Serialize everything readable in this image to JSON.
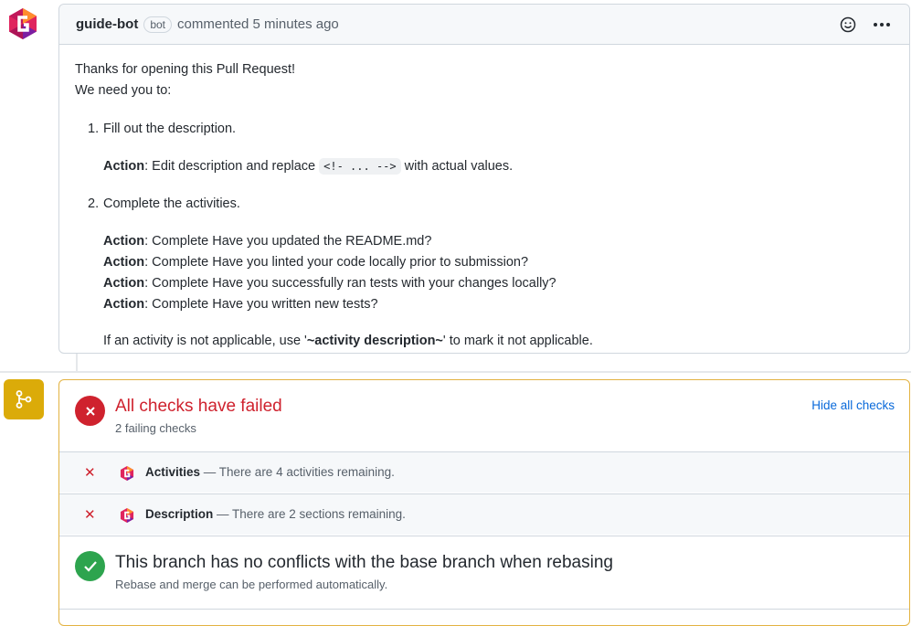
{
  "comment": {
    "author": "guide-bot",
    "badge": "bot",
    "timestamp": "commented 5 minutes ago",
    "intro_1": "Thanks for opening this Pull Request!",
    "intro_2": "We need you to:",
    "items": [
      {
        "number": "1.",
        "text": "Fill out the description.",
        "actions": [
          {
            "label": "Action",
            "text_before": ": Edit description and replace ",
            "code": "<!- ... -->",
            "text_after": " with actual values."
          }
        ]
      },
      {
        "number": "2.",
        "text": "Complete the activities.",
        "actions": [
          {
            "label": "Action",
            "text": ": Complete Have you updated the README.md?"
          },
          {
            "label": "Action",
            "text": ": Complete Have you linted your code locally prior to submission?"
          },
          {
            "label": "Action",
            "text": ": Complete Have you successfully ran tests with your changes locally?"
          },
          {
            "label": "Action",
            "text": ": Complete Have you written new tests?"
          }
        ]
      }
    ],
    "footer_before": "If an activity is not applicable, use '",
    "footer_bold": "~activity description~",
    "footer_after": "' to mark it not applicable."
  },
  "checks": {
    "title": "All checks have failed",
    "subtitle": "2 failing checks",
    "hide_link": "Hide all checks",
    "rows": [
      {
        "name": "Activities",
        "desc": " — There are 4 activities remaining."
      },
      {
        "name": "Description",
        "desc": " — There are 2 sections remaining."
      }
    ],
    "merge_title": "This branch has no conflicts with the base branch when rebasing",
    "merge_subtitle": "Rebase and merge can be performed automatically."
  },
  "icons": {
    "avatar": "guide-bot-logo-icon",
    "emoji": "smiley-icon",
    "more": "kebab-horizontal-icon",
    "status": "git-branch-icon",
    "fail": "x-circle-icon",
    "ok": "check-circle-icon"
  },
  "colors": {
    "fail": "#cf222e",
    "success": "#2da44e",
    "status_badge": "#dbab09",
    "link": "#0969da"
  }
}
